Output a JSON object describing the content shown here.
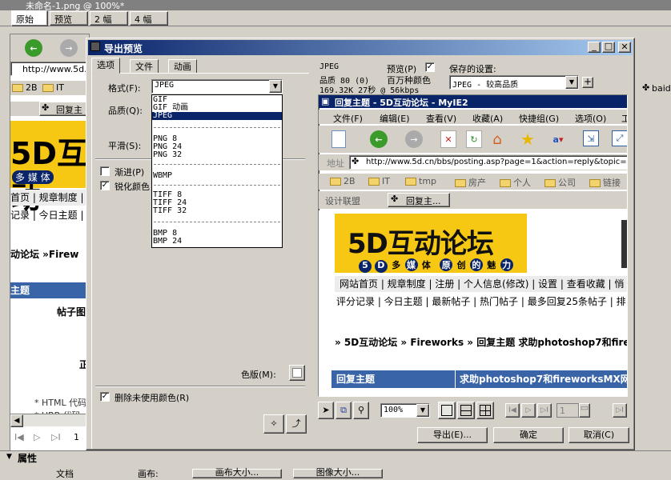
{
  "bg_app": {
    "doc_title": "未命名-1.png @ 100%*",
    "doc_tabs": [
      "原始",
      "预览",
      "2 幅",
      "4 幅"
    ],
    "address_prefix": "http://www.5d.",
    "fav_items": [
      "2B",
      "IT"
    ],
    "tab_label": "回复主",
    "logo_text": "互动",
    "logo_sub": "多 媒 体",
    "nav1": "首页 | 规章制度 |",
    "nav2": "记录 | 今日主题 |",
    "breadcrumb": "动论坛 »Firew",
    "table_head": "主题",
    "post_label": "帖子图",
    "left_char": "正",
    "html_code": "* HTML 代码",
    "ubb_code": "* UBB  代码",
    "page_num": "1",
    "properties_title": "属性",
    "prop_labels": [
      "文档",
      "画布:",
      "画布大小...",
      "图像大小..."
    ]
  },
  "dialog": {
    "title": "导出预览",
    "tabs": [
      "选项",
      "文件",
      "动画"
    ],
    "format_label": "格式(F):",
    "format_value": "JPEG",
    "quality_label": "品质(Q):",
    "smooth_label": "平滑(S):",
    "progressive_label": "渐进(P)",
    "sharpen_label": "锐化颜色",
    "remove_unused_label": "删除未使用颜色(R)",
    "matte_label": "色版(M):",
    "format_options": {
      "g1": [
        "GIF",
        "GIF 动画",
        "JPEG"
      ],
      "g2": [
        "PNG 8",
        "PNG 24",
        "PNG 32"
      ],
      "g3": [
        "WBMP"
      ],
      "g4": [
        "TIFF 8",
        "TIFF 24",
        "TIFF 32"
      ],
      "g5": [
        "BMP 8",
        "BMP 24"
      ]
    },
    "info_format": "JPEG",
    "info_quality": "品质 80 (0)",
    "info_size": "169.32K  27秒 @ 56kbps",
    "preview_label": "预览(P)",
    "color_count": "百万种颜色",
    "saved_settings_label": "保存的设置:",
    "saved_settings_value": "JPEG - 较高品质",
    "zoom_value": "100%",
    "frame_value": "1",
    "export_button": "导出(E)...",
    "ok_button": "确定",
    "cancel_button": "取消(C)"
  },
  "preview_page": {
    "window_title": "回复主题 - 5D互动论坛 - MyIE2",
    "menu": [
      "文件(F)",
      "编辑(E)",
      "查看(V)",
      "收藏(A)",
      "快捷组(G)",
      "选项(O)",
      "工"
    ],
    "address_label": "地址",
    "address_url": "http://www.5d.cn/bbs/posting.asp?page=1&action=reply&topic=1",
    "links": [
      "2B",
      "IT",
      "tmp",
      "房产",
      "个人",
      "公司",
      "链接"
    ],
    "tab_design": "设计联盟",
    "tab_active": "回复主...",
    "logo": "5D互动论坛",
    "logo_chars": [
      "5",
      "D",
      "多",
      "媒",
      "体",
      "原",
      "创",
      "的",
      "魅",
      "力"
    ],
    "nav1": "网站首页 | 规章制度 | 注册 | 个人信息(修改) | 设置 | 查看收藏 | 悄",
    "nav2": "评分记录 | 今日主题 | 最新帖子 | 热门帖子 | 最多回复25条帖子 | 排",
    "breadcrumb": "» 5D互动论坛 » Fireworks » 回复主题 求助photoshop7和firew",
    "table_col1": "回复主题",
    "table_col2": "求助photoshop7和fireworksMX网"
  },
  "bg_right": {
    "tab_label": "baid"
  },
  "colors": {
    "title_blue": "#0a246a",
    "forum_yellow": "#f6c813",
    "forum_blue": "#3a64a8",
    "nav_bg": "#ececec"
  }
}
